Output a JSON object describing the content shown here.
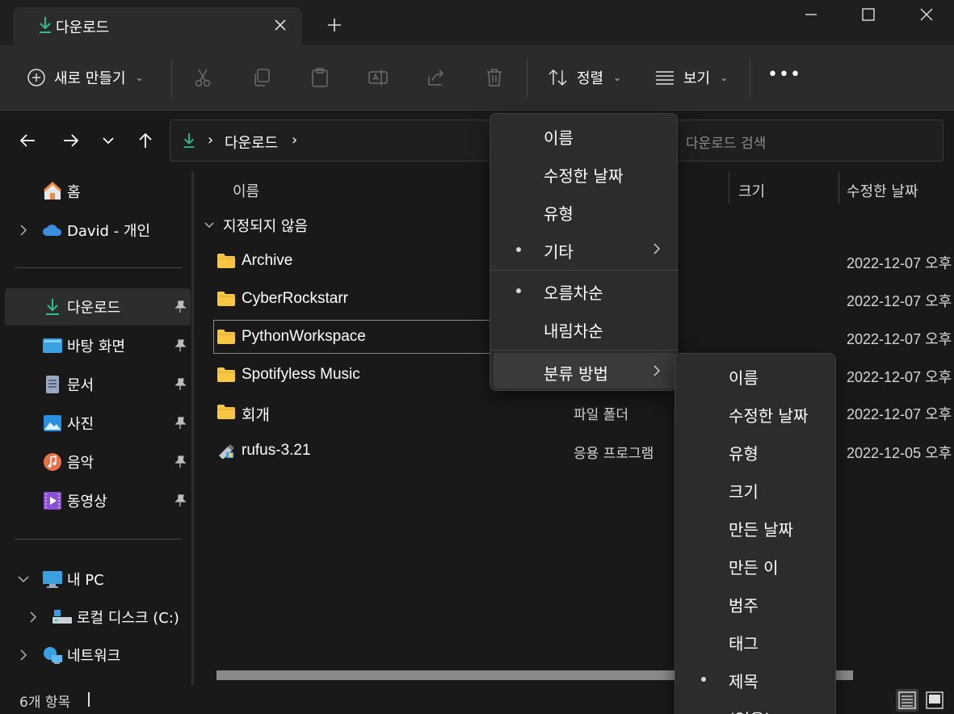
{
  "window": {
    "tab_title": "다운로드",
    "minimize_label": "",
    "maximize_label": "",
    "close_label": ""
  },
  "toolbar": {
    "new_label": "새로 만들기",
    "sort_label": "정렬",
    "view_label": "보기",
    "more_label": "•••"
  },
  "address": {
    "path": "다운로드",
    "search_placeholder": "다운로드 검색"
  },
  "sidebar": {
    "items": [
      {
        "label": "홈"
      },
      {
        "label": "David - 개인"
      },
      {
        "label": "다운로드"
      },
      {
        "label": "바탕 화면"
      },
      {
        "label": "문서"
      },
      {
        "label": "사진"
      },
      {
        "label": "음악"
      },
      {
        "label": "동영상"
      },
      {
        "label": "내 PC"
      },
      {
        "label": "로컬 디스크 (C:)"
      },
      {
        "label": "네트워크"
      }
    ]
  },
  "columns": {
    "name": "이름",
    "size": "크기",
    "modified": "수정한 날짜"
  },
  "group": {
    "label": "지정되지 않음"
  },
  "files": [
    {
      "name": "Archive",
      "type": "",
      "date": "2022-12-07 오후"
    },
    {
      "name": "CyberRockstarr",
      "type": "",
      "date": "2022-12-07 오후"
    },
    {
      "name": "PythonWorkspace",
      "type": "",
      "date": "2022-12-07 오후"
    },
    {
      "name": "Spotifyless Music",
      "type": "",
      "date": "2022-12-07 오후"
    },
    {
      "name": "회개",
      "type": "파일 폴더",
      "date": "2022-12-07 오후"
    },
    {
      "name": "rufus-3.21",
      "type": "응용 프로그램",
      "date": "2022-12-05 오후"
    }
  ],
  "status": {
    "item_count": "6개 항목"
  },
  "sort_menu": {
    "items": [
      {
        "label": "이름",
        "selected": false
      },
      {
        "label": "수정한 날짜",
        "selected": false
      },
      {
        "label": "유형",
        "selected": false
      },
      {
        "label": "기타",
        "selected": true
      },
      {
        "label": "오름차순",
        "selected": true
      },
      {
        "label": "내림차순",
        "selected": false
      },
      {
        "label": "분류 방법",
        "selected": false
      }
    ]
  },
  "group_menu": {
    "items": [
      {
        "label": "이름",
        "selected": false
      },
      {
        "label": "수정한 날짜",
        "selected": false
      },
      {
        "label": "유형",
        "selected": false
      },
      {
        "label": "크기",
        "selected": false
      },
      {
        "label": "만든 날짜",
        "selected": false
      },
      {
        "label": "만든 이",
        "selected": false
      },
      {
        "label": "범주",
        "selected": false
      },
      {
        "label": "태그",
        "selected": false
      },
      {
        "label": "제목",
        "selected": true
      },
      {
        "label": "(없음)",
        "selected": false
      }
    ]
  },
  "colors": {
    "accent_green": "#2fbf8f",
    "folder_yellow": "#f7c744",
    "background": "#191919"
  }
}
